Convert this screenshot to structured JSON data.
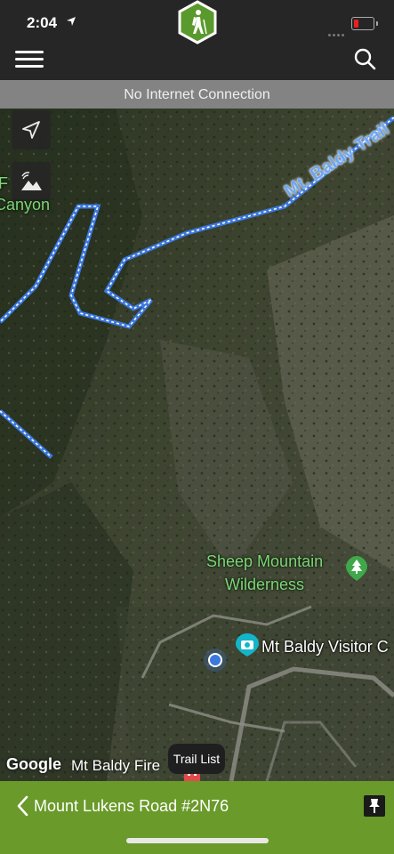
{
  "status_bar": {
    "time": "2:04",
    "location_icon": "location-arrow-icon",
    "signal": "dots-icon",
    "battery": "battery-low-icon",
    "battery_color": "#e82020"
  },
  "header": {
    "menu_icon": "hamburger-menu-icon",
    "logo": "hiker-hexagon-logo",
    "search_icon": "search-icon",
    "logo_color": "#5a9a2c"
  },
  "banner": {
    "text": "No Internet Connection"
  },
  "map": {
    "controls": [
      {
        "icon": "navigation-arrow-icon"
      },
      {
        "icon": "terrain-layers-icon"
      }
    ],
    "labels": {
      "fragment": "F",
      "canyon": "Canyon",
      "trail": "Mt. Baldy Trail",
      "sheep_line1": "Sheep Mountain",
      "sheep_line2": "Wilderness",
      "visitor": "Mt Baldy Visitor C",
      "fire": "Mt Baldy Fire",
      "google": "Google"
    },
    "trail_color": "#4a86e8",
    "park_label_color": "#7fd47a"
  },
  "trail_list": {
    "label": "Trail List"
  },
  "bottom_bar": {
    "trail_name": "Mount Lukens Road #2N76",
    "back_icon": "chevron-left-icon",
    "pin_icon": "pin-icon",
    "color": "#6a9a2a"
  }
}
